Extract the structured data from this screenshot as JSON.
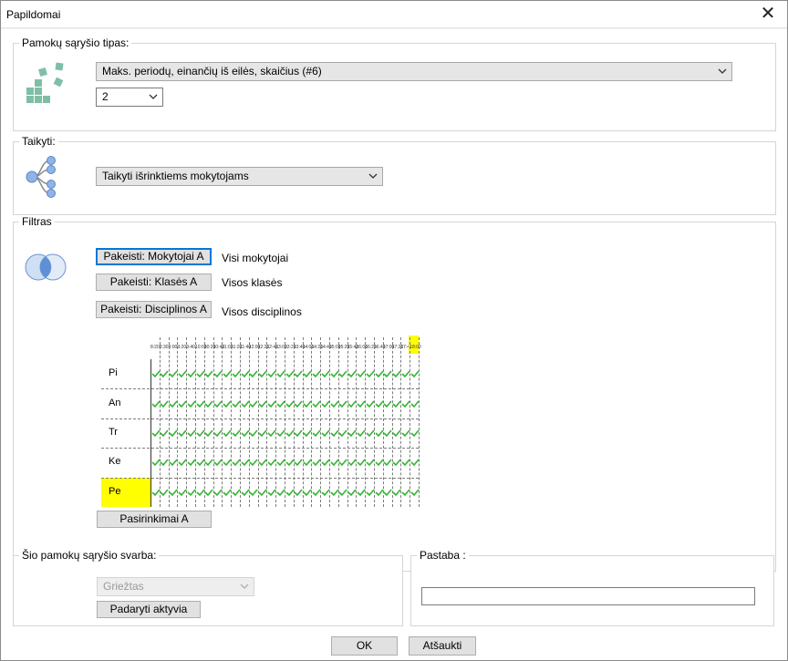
{
  "window": {
    "title": "Papildomai"
  },
  "relation_type": {
    "legend": "Pamokų sąryšio tipas:",
    "selected": "Maks. periodų, einančių iš eilės, skaičius (#6)",
    "count_value": "2",
    "icon": "blocks-icon"
  },
  "apply": {
    "legend": "Taikyti:",
    "selected": "Taikyti išrinktiems mokytojams",
    "icon": "tree-branch-icon"
  },
  "filter": {
    "legend": "Filtras",
    "icon": "venn-diagram-icon",
    "rows": [
      {
        "button": "Pakeisti: Mokytojai A",
        "value": "Visi mokytojai"
      },
      {
        "button": "Pakeisti: Klasės A",
        "value": "Visos klasės"
      },
      {
        "button": "Pakeisti: Disciplinos A",
        "value": "Visos disciplinos"
      }
    ],
    "grid": {
      "time_labels": [
        "8:20",
        "8:30",
        "9:00",
        "9:20",
        "9:40",
        "10:00",
        "10:20",
        "10:40",
        "11:00",
        "11:20",
        "11:40",
        "12:00",
        "12:20",
        "12:40",
        "13:00",
        "13:20",
        "13:40",
        "14:00",
        "14:20",
        "14:40",
        "15:00",
        "15:20",
        "15:40",
        "16:00",
        "16:20",
        "16:40",
        "17:00",
        "17:20",
        "17:40",
        "18:00"
      ],
      "highlight_time_index": 29,
      "days": [
        "Pi",
        "An",
        "Tr",
        "Ke",
        "Pe"
      ],
      "highlight_day_index": 4,
      "check_color": "#2fb52f",
      "highlight_color": "#ffff00"
    },
    "selections_button": "Pasirinkimai A"
  },
  "importance": {
    "legend": "Šio pamokų sąryšio svarba:",
    "selected": "Griežtas",
    "activate_button": "Padaryti aktyvia"
  },
  "note": {
    "legend": "Pastaba :",
    "value": ""
  },
  "footer": {
    "ok": "OK",
    "cancel": "Atšaukti"
  }
}
